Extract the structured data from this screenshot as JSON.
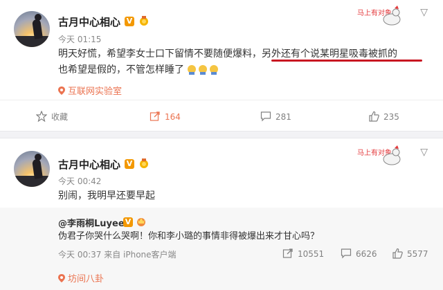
{
  "post1": {
    "username": "古月中心相心",
    "verified_badge": "V",
    "time": "今天 01:15",
    "text_line1": "明天好慌，希望李女士口下留情不要随便爆料，",
    "text_line1_highlight": "另外还有个说某明星吸毒被抓的",
    "text_line2": "也希望是假的，不管怎样睡了",
    "source": "互联网实验室",
    "actions": {
      "favorite_label": "收藏",
      "share_count": "164",
      "comment_count": "281",
      "like_count": "235"
    },
    "colors": {
      "highlight_underline": "#c81521",
      "accent": "#eb7350"
    }
  },
  "post2": {
    "username": "古月中心相心",
    "verified_badge": "V",
    "time": "今天 00:42",
    "text": "别闹，我明早还要早起",
    "repost": {
      "author": "@李雨桐Luyee",
      "verified_badge": "V",
      "text": "伪君子你哭什么哭啊！你和李小璐的事情非得被爆出来才甘心吗？",
      "time": "今天 00:37 来自 iPhone客户端",
      "share_count": "10551",
      "comment_count": "6626",
      "like_count": "5577"
    },
    "source": "坊间八卦"
  },
  "sticker_text": "马上有对象"
}
